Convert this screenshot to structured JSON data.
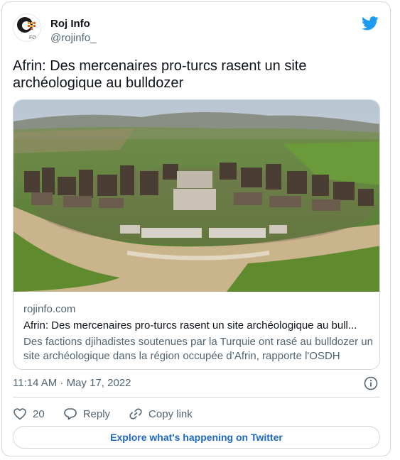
{
  "author": {
    "name": "Roj Info",
    "handle": "@rojinfo_",
    "avatar_icon": "rojinfo-logo-icon"
  },
  "brand_icon": "twitter-bird-icon",
  "tweet": {
    "text": "Afrin: Des mercenaires pro-turcs rasent un site archéologique au bulldozer"
  },
  "link_card": {
    "image": "archaeological-site-photo",
    "domain": "rojinfo.com",
    "title": "Afrin: Des mercenaires pro-turcs rasent un site archéologique au bull...",
    "description": "Des factions djihadistes soutenues par la Turquie ont rasé au bulldozer un site archéologique dans la région occupée d’Afrin, rapporte l'OSDH"
  },
  "timestamp": "11:14 AM · May 17, 2022",
  "actions": {
    "like_count": "20",
    "reply_label": "Reply",
    "copy_link_label": "Copy link"
  },
  "explore_label": "Explore what's happening on Twitter",
  "colors": {
    "accent": "#1d9bf0",
    "link_text": "#1d68c7",
    "secondary_text": "#536471",
    "border": "#cfd9de"
  }
}
